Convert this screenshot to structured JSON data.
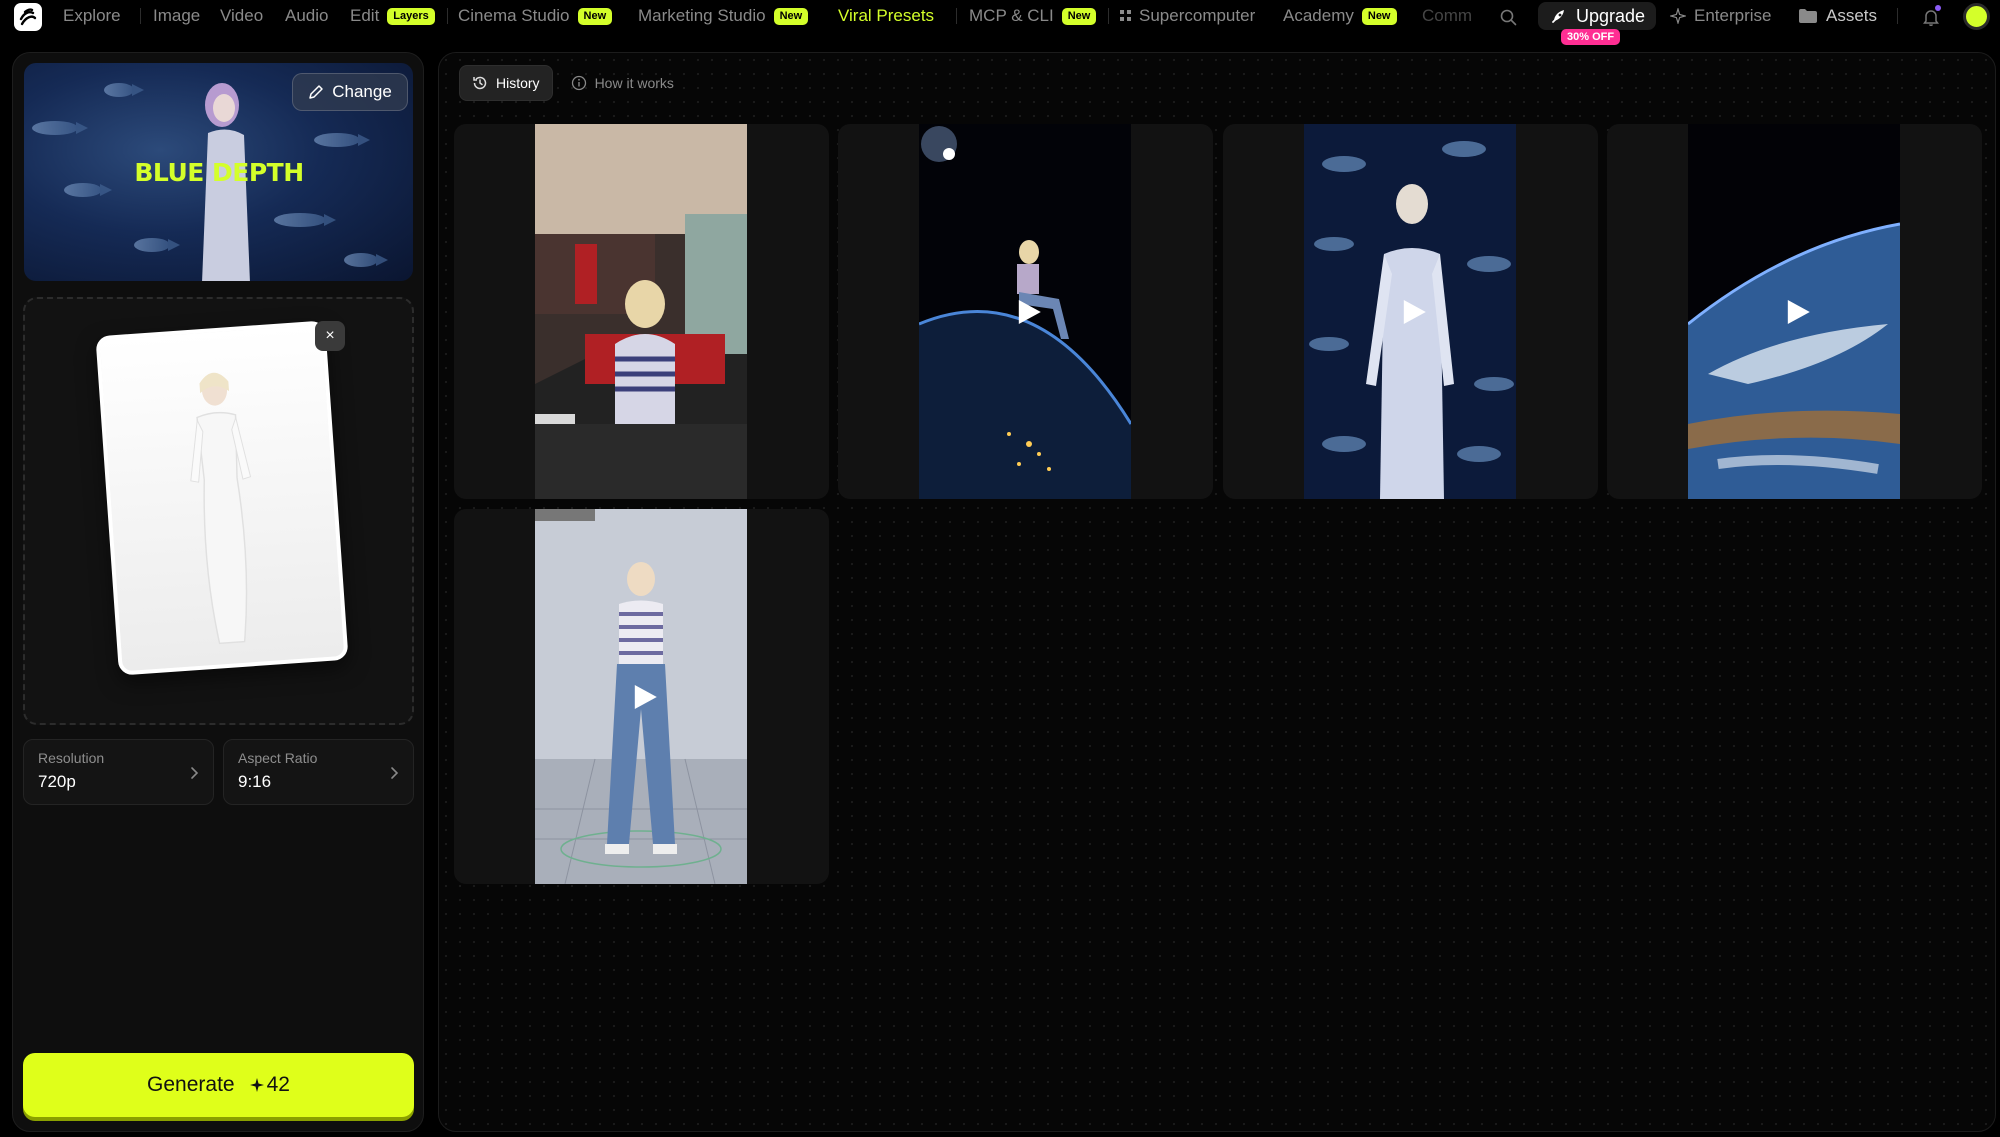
{
  "nav": {
    "items": [
      {
        "label": "Explore"
      },
      {
        "label": "Image"
      },
      {
        "label": "Video"
      },
      {
        "label": "Audio"
      },
      {
        "label": "Edit",
        "badge": "Layers"
      },
      {
        "label": "Cinema Studio",
        "badge": "New"
      },
      {
        "label": "Marketing Studio",
        "badge": "New"
      },
      {
        "label": "Viral Presets"
      },
      {
        "label": "MCP & CLI",
        "badge": "New"
      },
      {
        "label": "Supercomputer"
      },
      {
        "label": "Academy",
        "badge": "New"
      },
      {
        "label": "Comm"
      }
    ],
    "upgrade_label": "Upgrade",
    "upgrade_badge": "30% OFF",
    "enterprise_label": "Enterprise",
    "assets_label": "Assets",
    "accent_color": "#d4ff2a",
    "badge_color": "#ff2e93"
  },
  "sidebar": {
    "preset_title": "BLUE DEPTH",
    "change_label": "Change",
    "remove_label": "×",
    "resolution": {
      "label": "Resolution",
      "value": "720p"
    },
    "aspect_ratio": {
      "label": "Aspect Ratio",
      "value": "9:16"
    },
    "generate_label": "Generate",
    "generate_cost": "42"
  },
  "main": {
    "tabs": [
      {
        "label": "History",
        "icon": "history-icon",
        "active": true
      },
      {
        "label": "How it works",
        "icon": "info-icon",
        "active": false
      }
    ],
    "gallery": [
      {
        "scene": "diner",
        "has_play": false
      },
      {
        "scene": "earth-sitting",
        "has_play": true
      },
      {
        "scene": "aquarium",
        "has_play": true
      },
      {
        "scene": "earth-orbit",
        "has_play": true
      },
      {
        "scene": "turnaround",
        "has_play": true
      }
    ]
  }
}
